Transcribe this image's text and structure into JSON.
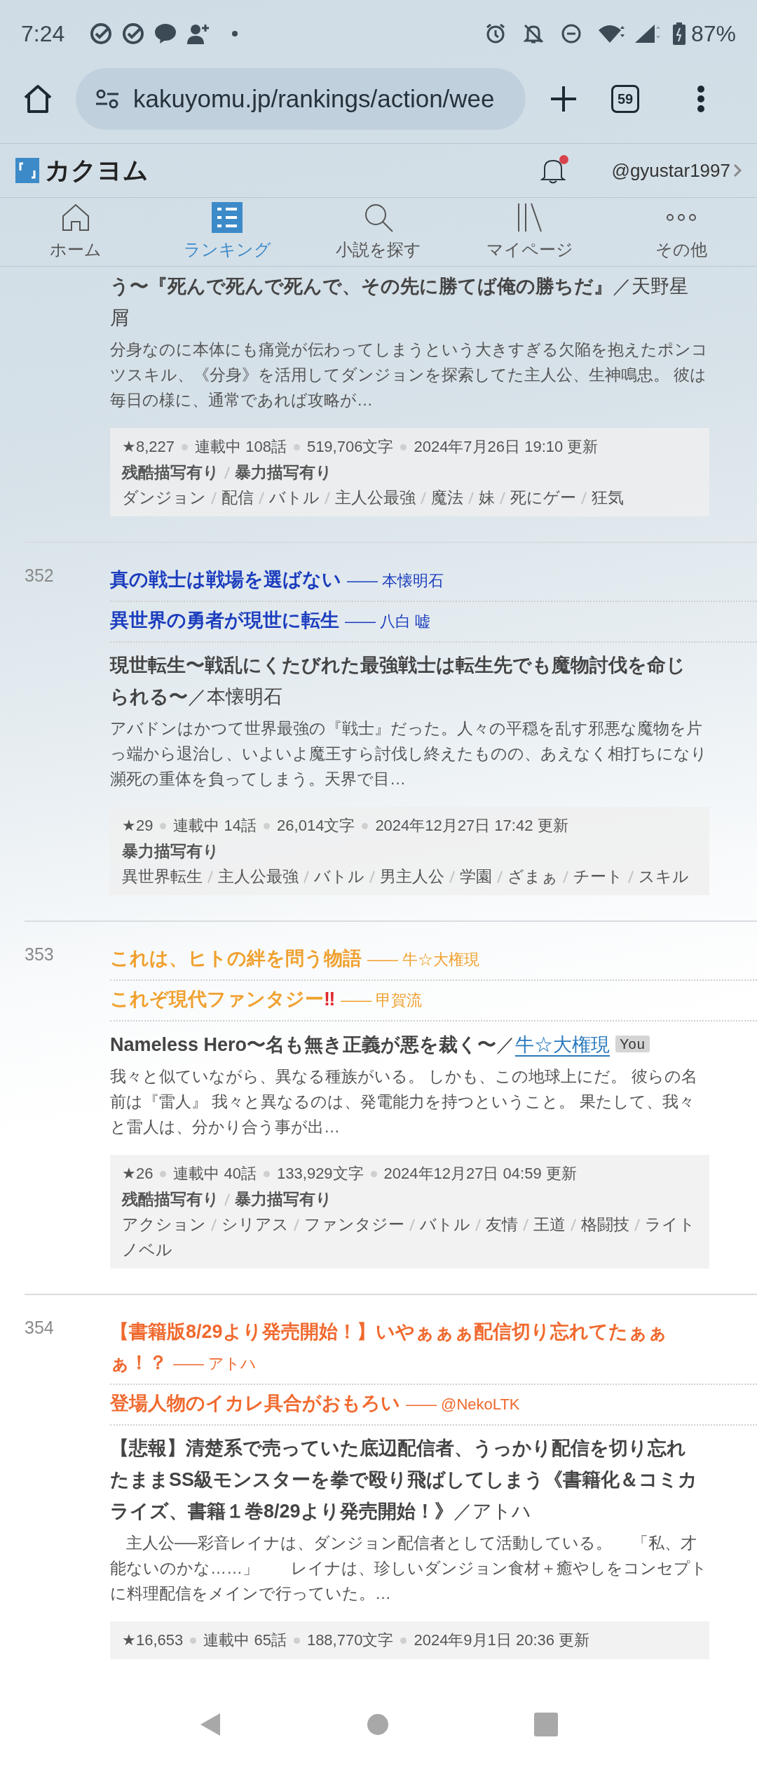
{
  "status_bar": {
    "time": "7:24",
    "battery": "87%"
  },
  "browser": {
    "url": "kakuyomu.jp/rankings/action/wee",
    "tab_count": "59"
  },
  "site_header": {
    "logo": "カクヨム",
    "user": "@gyustar1997",
    "has_notification": true
  },
  "nav": [
    {
      "label": "ホーム",
      "selected": false
    },
    {
      "label": "ランキング",
      "selected": true
    },
    {
      "label": "小説を探す",
      "selected": false
    },
    {
      "label": "マイページ",
      "selected": false
    },
    {
      "label": "その他",
      "selected": false
    }
  ],
  "entries": [
    {
      "work": {
        "title": "う〜『死んで死んで死んで、その先に勝てば俺の勝ちだ』",
        "separator": "／",
        "author": "天野星屑",
        "author_link": false
      },
      "description": "分身なのに本体にも痛覚が伝わってしまうという大きすぎる欠陥を抱えたポンコツスキル、《分身》を活用してダンジョンを探索してた主人公、生神鳴忠。 彼は毎日の様に、通常であれば攻略が…",
      "meta": [
        "★8,227",
        "連載中 108話",
        "519,706文字",
        "2024年7月26日 19:10 更新"
      ],
      "warnings": [
        "残酷描写有り",
        "暴力描写有り"
      ],
      "tags": [
        "ダンジョン",
        "配信",
        "バトル",
        "主人公最強",
        "魔法",
        "妹",
        "死にゲー",
        "狂気"
      ]
    },
    {
      "rank": "352",
      "color": "#1b3dbe",
      "reviews": [
        {
          "title": "真の戦士は戦場を選ばない",
          "byline": "—— 本懐明石"
        },
        {
          "title": "異世界の勇者が現世に転生",
          "byline": "—— 八白 嘘"
        }
      ],
      "work": {
        "title": "現世転生〜戦乱にくたびれた最強戦士は転生先でも魔物討伐を命じられる〜",
        "separator": "／",
        "author": "本懐明石",
        "author_link": false
      },
      "description": "アバドンはかつて世界最強の『戦士』だった。人々の平穏を乱す邪悪な魔物を片っ端から退治し、いよいよ魔王すら討伐し終えたものの、あえなく相打ちになり瀕死の重体を負ってしまう。天界で目…",
      "meta": [
        "★29",
        "連載中 14話",
        "26,014文字",
        "2024年12月27日 17:42 更新"
      ],
      "warnings": [
        "暴力描写有り"
      ],
      "tags": [
        "異世界転生",
        "主人公最強",
        "バトル",
        "男主人公",
        "学園",
        "ざまぁ",
        "チート",
        "スキル"
      ]
    },
    {
      "rank": "353",
      "color": "#f0a02e",
      "reviews": [
        {
          "title": "これは、ヒトの絆を問う物語",
          "byline": "—— 牛☆大権現"
        },
        {
          "title": "これぞ現代ファンタジー",
          "mark": "‼",
          "byline": "—— 甲賀流"
        }
      ],
      "work": {
        "title": "Nameless Hero〜名も無き正義が悪を裁く〜",
        "separator": "／",
        "author": "牛☆大権現",
        "author_link": true,
        "badge": "You"
      },
      "description": "我々と似ていながら、異なる種族がいる。 しかも、この地球上にだ。 彼らの名前は『雷人』 我々と異なるのは、発電能力を持つということ。 果たして、我々と雷人は、分かり合う事が出…",
      "meta": [
        "★26",
        "連載中 40話",
        "133,929文字",
        "2024年12月27日 04:59 更新"
      ],
      "warnings": [
        "残酷描写有り",
        "暴力描写有り"
      ],
      "tags": [
        "アクション",
        "シリアス",
        "ファンタジー",
        "バトル",
        "友情",
        "王道",
        "格闘技",
        "ライトノベル"
      ]
    },
    {
      "rank": "354",
      "color": "#f0692e",
      "reviews": [
        {
          "title": "【書籍版8/29より発売開始！】いやぁぁぁ配信切り忘れてたぁぁぁ！？",
          "byline": "—— アトハ"
        },
        {
          "title": "登場人物のイカレ具合がおもろい",
          "byline": "—— @NekoLTK"
        }
      ],
      "work": {
        "title": "【悲報】清楚系で売っていた底辺配信者、うっかり配信を切り忘れたままSS級モンスターを拳で殴り飛ばしてしまう《書籍化＆コミカライズ、書籍１巻8/29より発売開始！》",
        "separator": "／",
        "author": "アトハ",
        "author_link": false
      },
      "description": "　主人公──彩音レイナは、ダンジョン配信者として活動している。 　「私、才能ないのかな……」　　レイナは、珍しいダンジョン食材＋癒やしをコンセプトに料理配信をメインで行っていた。…",
      "meta": [
        "★16,653",
        "連載中 65話",
        "188,770文字",
        "2024年9月1日 20:36 更新"
      ]
    }
  ]
}
